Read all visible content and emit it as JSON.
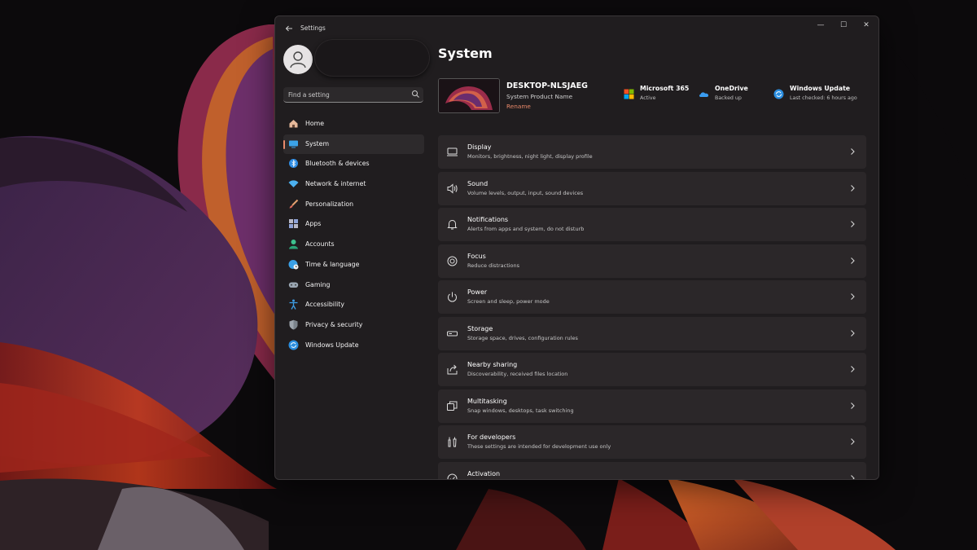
{
  "window": {
    "title": "Settings",
    "controls": {
      "minimize": "—",
      "maximize": "☐",
      "close": "✕"
    }
  },
  "search": {
    "placeholder": "Find a setting"
  },
  "sidebar": {
    "items": [
      {
        "label": "Home",
        "icon": "home-icon",
        "selected": false
      },
      {
        "label": "System",
        "icon": "system-icon",
        "selected": true
      },
      {
        "label": "Bluetooth & devices",
        "icon": "bluetooth-icon",
        "selected": false
      },
      {
        "label": "Network & internet",
        "icon": "wifi-icon",
        "selected": false
      },
      {
        "label": "Personalization",
        "icon": "brush-icon",
        "selected": false
      },
      {
        "label": "Apps",
        "icon": "apps-icon",
        "selected": false
      },
      {
        "label": "Accounts",
        "icon": "accounts-icon",
        "selected": false
      },
      {
        "label": "Time & language",
        "icon": "globe-clock-icon",
        "selected": false
      },
      {
        "label": "Gaming",
        "icon": "gamepad-icon",
        "selected": false
      },
      {
        "label": "Accessibility",
        "icon": "accessibility-icon",
        "selected": false
      },
      {
        "label": "Privacy & security",
        "icon": "shield-icon",
        "selected": false
      },
      {
        "label": "Windows Update",
        "icon": "update-icon",
        "selected": false
      }
    ]
  },
  "main": {
    "title": "System",
    "device": {
      "name": "DESKTOP-NLSJAEG",
      "model": "System Product Name",
      "rename": "Rename"
    },
    "status": [
      {
        "title": "Microsoft 365",
        "sub": "Active",
        "icon": "microsoft-365-icon"
      },
      {
        "title": "OneDrive",
        "sub": "Backed up",
        "icon": "onedrive-icon"
      },
      {
        "title": "Windows Update",
        "sub": "Last checked: 6 hours ago",
        "icon": "windows-update-icon"
      }
    ],
    "cards": [
      {
        "title": "Display",
        "sub": "Monitors, brightness, night light, display profile",
        "icon": "display-icon"
      },
      {
        "title": "Sound",
        "sub": "Volume levels, output, input, sound devices",
        "icon": "sound-icon"
      },
      {
        "title": "Notifications",
        "sub": "Alerts from apps and system, do not disturb",
        "icon": "bell-icon"
      },
      {
        "title": "Focus",
        "sub": "Reduce distractions",
        "icon": "focus-icon"
      },
      {
        "title": "Power",
        "sub": "Screen and sleep, power mode",
        "icon": "power-icon"
      },
      {
        "title": "Storage",
        "sub": "Storage space, drives, configuration rules",
        "icon": "storage-icon"
      },
      {
        "title": "Nearby sharing",
        "sub": "Discoverability, received files location",
        "icon": "share-icon"
      },
      {
        "title": "Multitasking",
        "sub": "Snap windows, desktops, task switching",
        "icon": "multitasking-icon"
      },
      {
        "title": "For developers",
        "sub": "These settings are intended for development use only",
        "icon": "developer-icon"
      },
      {
        "title": "Activation",
        "sub": "",
        "icon": "activation-icon"
      }
    ]
  },
  "colors": {
    "accent": "#e9896a",
    "window_bg": "#201d1f",
    "card_bg": "#2b2729"
  }
}
